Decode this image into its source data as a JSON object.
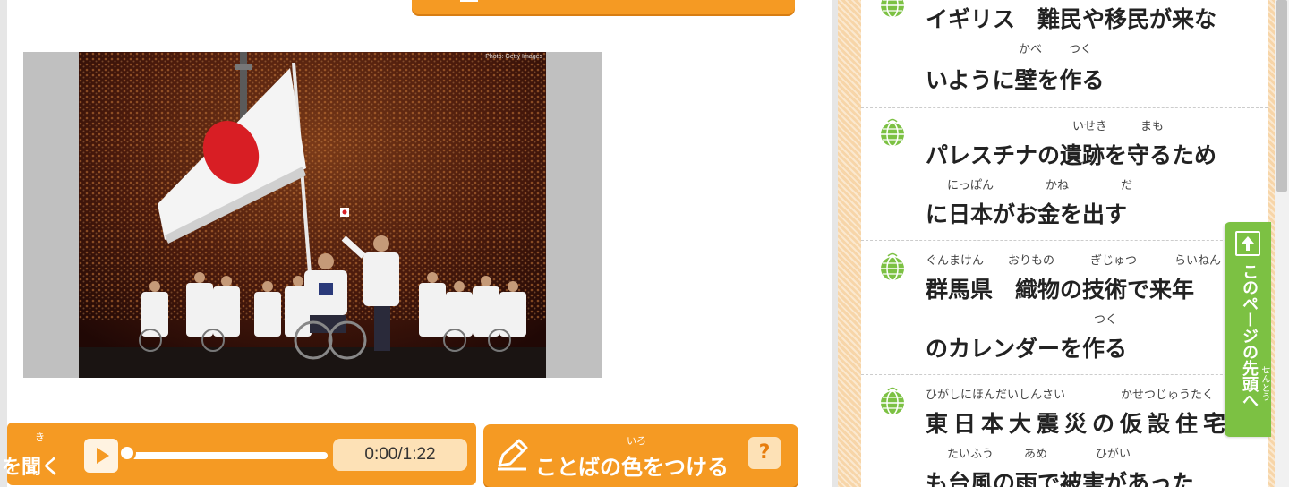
{
  "photo": {
    "credit": "Photo: Getty Images"
  },
  "player": {
    "label": "を聞く",
    "ruby": "き",
    "time": "0:00/1:22",
    "progress": 0
  },
  "color_button": {
    "label": "ことばの色をつける",
    "ruby": "いろ",
    "help": "?"
  },
  "news": [
    {
      "lines": [
        "イギリス　難民や移民が来な",
        "いように壁を作る"
      ],
      "rubies": [
        "かべ",
        "つく"
      ]
    },
    {
      "lines": [
        "パレスチナの遺跡を守るため",
        "に日本がお金を出す"
      ],
      "rubies": [
        "いせき",
        "まも",
        "にっぽん",
        "かね",
        "だ"
      ]
    },
    {
      "lines": [
        "群馬県　織物の技術で来年",
        "のカレンダーを作る"
      ],
      "rubies": [
        "ぐんまけん",
        "おりもの",
        "ぎじゅつ",
        "らいねん",
        "つく"
      ]
    },
    {
      "lines": [
        "東日本大震災の仮設住宅",
        "も台風の雨で被害があった"
      ],
      "rubies": [
        "ひがしにほんだいしんさい",
        "かせつじゅうたく",
        "たいふう",
        "あめ",
        "ひがい"
      ]
    }
  ],
  "back_to_top": {
    "label": "このページの先頭へ",
    "ruby": "せんとう"
  },
  "colors": {
    "orange": "#f59a23",
    "green": "#7cc143",
    "peach": "#fde1b6"
  }
}
